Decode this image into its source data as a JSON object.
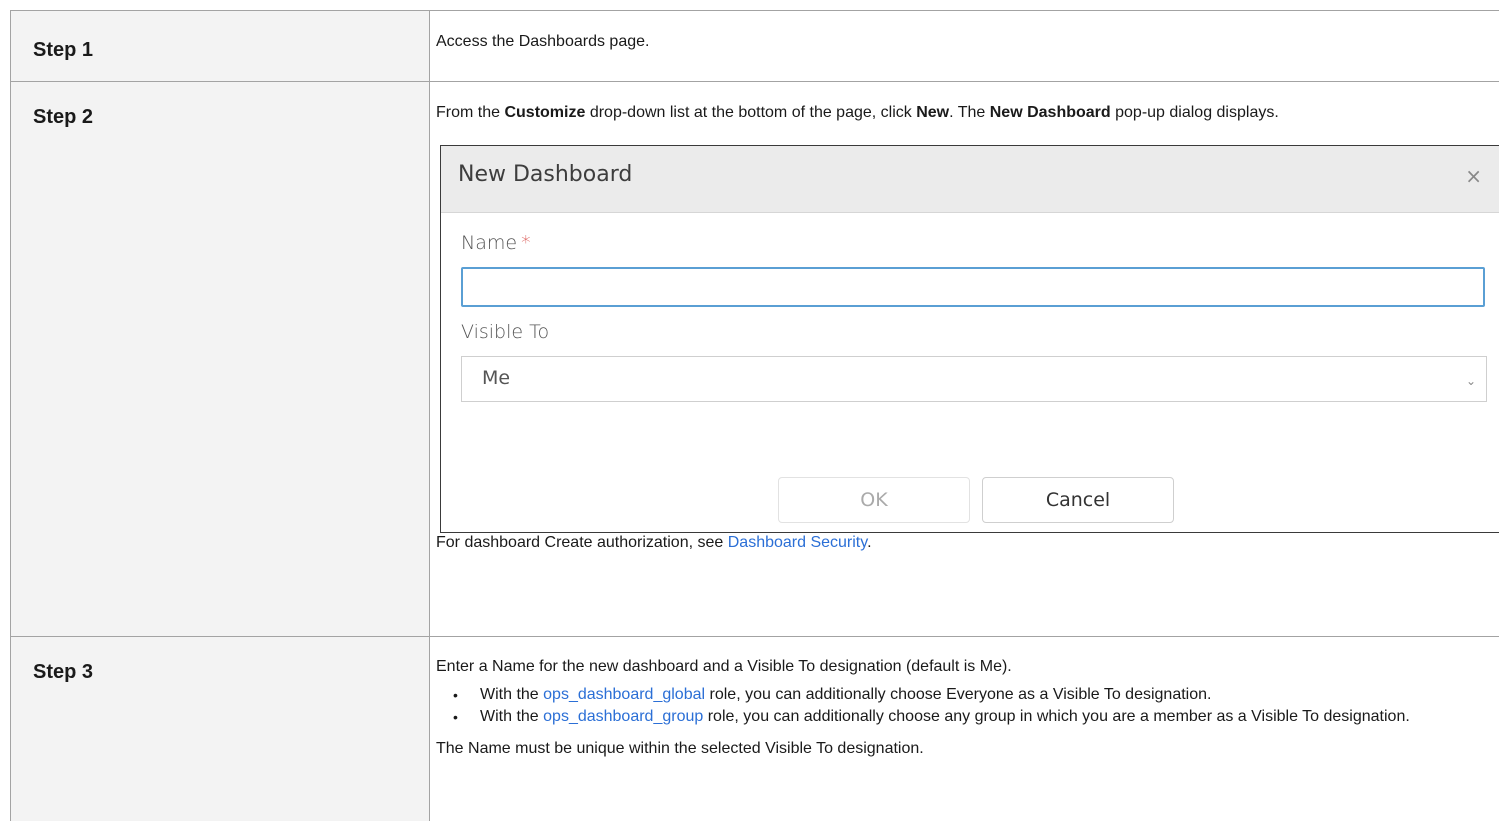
{
  "steps": [
    {
      "label": "Step 1",
      "text": "Access the Dashboards page."
    },
    {
      "label": "Step 2",
      "intro": {
        "t1": "From the ",
        "b1": "Customize",
        "t2": " drop-down list at the bottom of the page, click ",
        "b2": "New",
        "t3": ". The ",
        "b3": "New Dashboard",
        "t4": " pop-up dialog displays."
      },
      "dialog": {
        "title": "New Dashboard",
        "close_glyph": "×",
        "name_label": "Name",
        "required_mark": "*",
        "name_value": "",
        "visible_label": "Visible To",
        "visible_value": "Me",
        "chevron_glyph": "⌄",
        "ok_label": "OK",
        "cancel_label": "Cancel"
      },
      "after": {
        "text": "For dashboard Create authorization, see ",
        "link": "Dashboard Security",
        "end": "."
      }
    },
    {
      "label": "Step 3",
      "intro": "Enter a Name for the new dashboard and a Visible To designation (default is Me).",
      "bullets": [
        {
          "dot": "•",
          "pre": "With the ",
          "link": "ops_dashboard_global",
          "post": " role, you can additionally choose Everyone as a Visible To designation."
        },
        {
          "dot": "•",
          "pre": "With the ",
          "link": "ops_dashboard_group",
          "post": " role, you can additionally choose any group in which you are a member as a Visible To designation."
        }
      ],
      "final": "The Name must be unique within the selected Visible To designation."
    }
  ],
  "colors": {
    "link": "#2b6fd6",
    "step_cell_bg": "#f3f3f3",
    "required": "#d9534f",
    "focus_border": "#5a9fd4"
  }
}
